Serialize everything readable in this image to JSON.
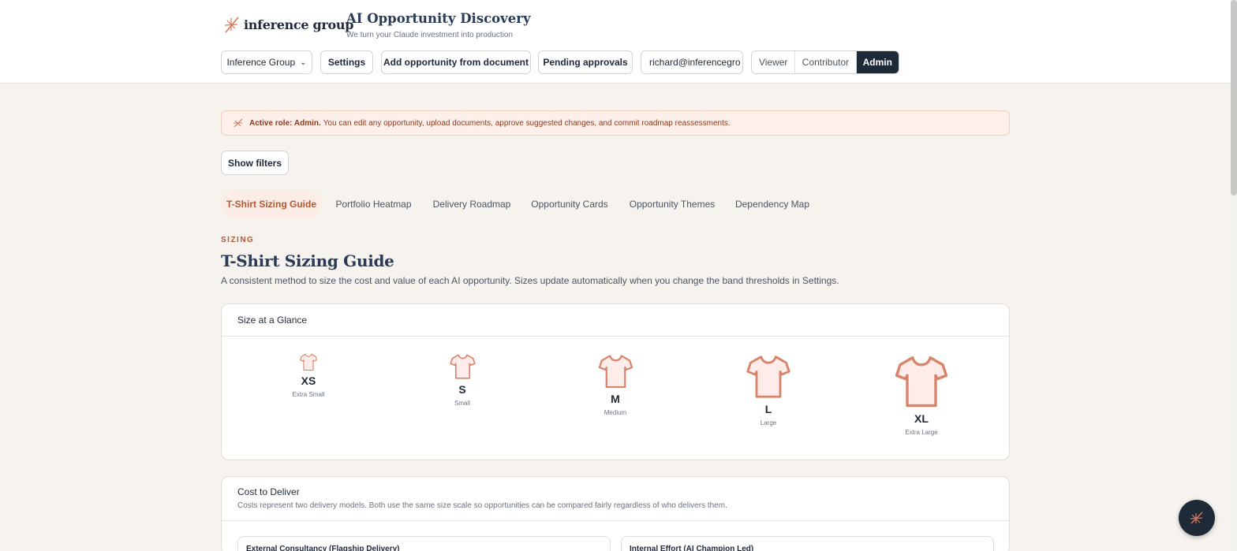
{
  "brand": {
    "name": "inference group",
    "logo_icon": "sparkle-icon"
  },
  "app": {
    "title": "AI Opportunity Discovery",
    "subtitle": "We turn your Claude investment into production"
  },
  "toolbar": {
    "org_select": "Inference Group",
    "settings_label": "Settings",
    "add_doc_label": "Add opportunity from document",
    "pending_label": "Pending approvals",
    "user_email": "richard@inferencegro",
    "roles": [
      "Viewer",
      "Contributor",
      "Admin"
    ],
    "active_role": "Admin"
  },
  "notice": {
    "icon": "sparkle-icon",
    "bold": "Active role: Admin.",
    "text": "You can edit any opportunity, upload documents, approve suggested changes, and commit roadmap reassessments."
  },
  "filters": {
    "label": "Show filters"
  },
  "tabs": [
    {
      "label": "T-Shirt Sizing Guide",
      "active": true
    },
    {
      "label": "Portfolio Heatmap",
      "active": false
    },
    {
      "label": "Delivery Roadmap",
      "active": false
    },
    {
      "label": "Opportunity Cards",
      "active": false
    },
    {
      "label": "Opportunity Themes",
      "active": false
    },
    {
      "label": "Dependency Map",
      "active": false
    }
  ],
  "section": {
    "eyebrow": "SIZING",
    "title": "T-Shirt Sizing Guide",
    "description": "A consistent method to size the cost and value of each AI opportunity. Sizes update automatically when you change the band thresholds in Settings."
  },
  "glance": {
    "title": "Size at a Glance",
    "sizes": [
      {
        "code": "XS",
        "name": "Extra Small",
        "icon": "tshirt-icon"
      },
      {
        "code": "S",
        "name": "Small",
        "icon": "tshirt-icon"
      },
      {
        "code": "M",
        "name": "Medium",
        "icon": "tshirt-icon"
      },
      {
        "code": "L",
        "name": "Large",
        "icon": "tshirt-icon"
      },
      {
        "code": "XL",
        "name": "Extra Large",
        "icon": "tshirt-icon"
      }
    ]
  },
  "cost": {
    "title": "Cost to Deliver",
    "subtitle": "Costs represent two delivery models. Both use the same size scale so opportunities can be compared fairly regardless of who delivers them.",
    "models": [
      "External Consultancy (Flagship Delivery)",
      "Internal Effort (AI Champion Led)"
    ]
  },
  "colors": {
    "accent": "#b45735",
    "navy": "#1e2a38",
    "shirt_stroke": "#d9846a",
    "shirt_fill": "#fdecea"
  }
}
